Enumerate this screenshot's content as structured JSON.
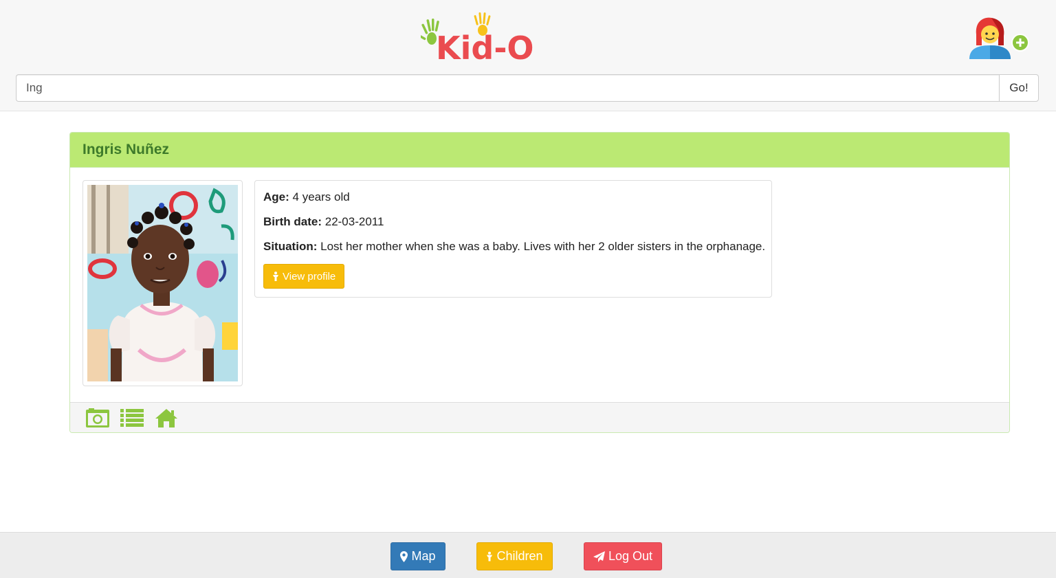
{
  "header": {
    "logo_text": "Kid-O",
    "search": {
      "value": "Ing",
      "go_label": "Go!"
    },
    "add_user_icon": "add-user-icon"
  },
  "child": {
    "name": "Ingris Nuñez",
    "age_label": "Age:",
    "age_value": "4 years old",
    "birth_label": "Birth date:",
    "birth_value": "22-03-2011",
    "situation_label": "Situation:",
    "situation_value": "Lost her mother when she was a baby. Lives with her 2 older sisters in the orphanage.",
    "view_profile_label": "View profile"
  },
  "panel_footer": {
    "icons": [
      "camera-icon",
      "list-icon",
      "home-icon"
    ]
  },
  "nav": {
    "map_label": "Map",
    "children_label": "Children",
    "logout_label": "Log Out"
  },
  "colors": {
    "brand_green": "#8cc63f",
    "panel_heading": "#bbe973",
    "title_green": "#3d7a2a",
    "warning_yellow": "#f7bc0a",
    "primary_blue": "#337ab7",
    "danger_red": "#f0505a"
  }
}
